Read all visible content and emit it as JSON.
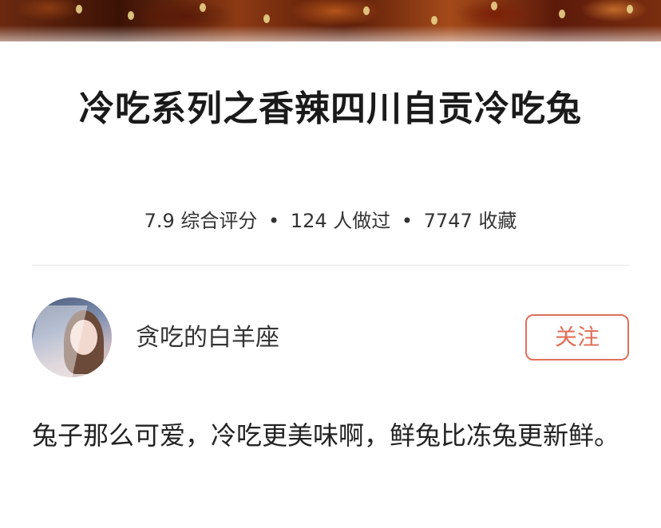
{
  "recipe": {
    "title": "冷吃系列之香辣四川自贡冷吃兔",
    "stats": {
      "score": "7.9 综合评分",
      "cooked": "124 人做过",
      "favorites": "7747 收藏",
      "separator": "•"
    },
    "description": "兔子那么可爱，冷吃更美味啊，鲜兔比冻兔更新鲜。"
  },
  "author": {
    "name": "贪吃的白羊座",
    "follow_label": "关注"
  },
  "colors": {
    "accent": "#e0705a",
    "text": "#222222",
    "divider": "#e6e6e6"
  }
}
